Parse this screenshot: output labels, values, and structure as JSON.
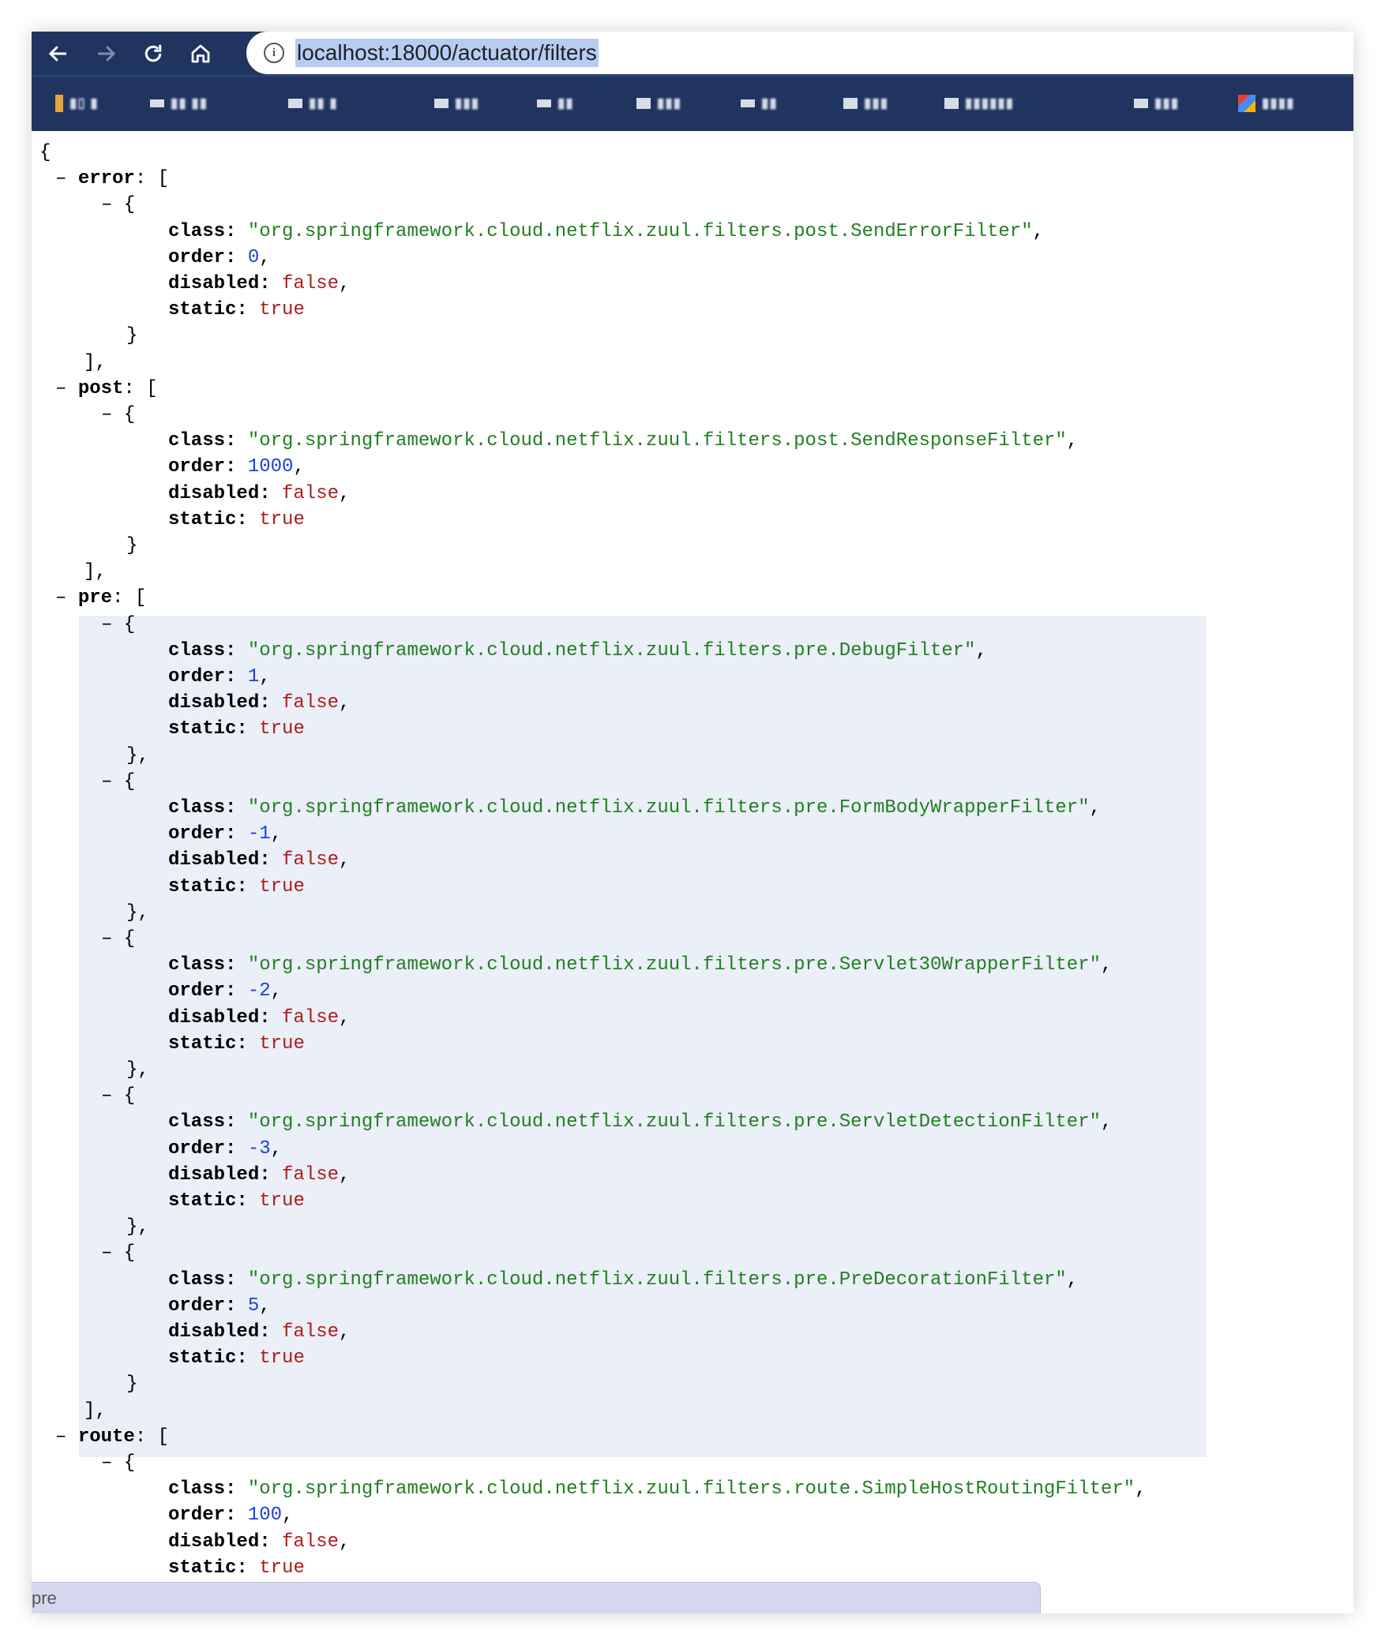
{
  "browser": {
    "url": "localhost:18000/actuator/filters",
    "nav": {
      "back": "←",
      "forward": "→",
      "reload": "⟳",
      "home": "⌂"
    },
    "bookmarks": [
      {
        "label": "▮▯ ▮"
      },
      {
        "label": "▮▮ ▮▮"
      },
      {
        "label": "▮▮ ▮"
      },
      {
        "label": "▮▮▮"
      },
      {
        "label": "▮▮"
      },
      {
        "label": "▮▮▮"
      },
      {
        "label": "▮▮"
      },
      {
        "label": "▮▮▮"
      },
      {
        "label": "▮▮▮▮▮▮"
      },
      {
        "label": "▮▮▮"
      },
      {
        "label": "▮▮▮▮"
      }
    ]
  },
  "json": {
    "open_brace": "{",
    "collapse_glyph": "–",
    "groups": [
      {
        "key": "error",
        "close": "],",
        "items": [
          {
            "class": "\"org.springframework.cloud.netflix.zuul.filters.post.SendErrorFilter\"",
            "order": "0",
            "disabled": "false",
            "static": "true",
            "close": "}"
          }
        ]
      },
      {
        "key": "post",
        "close": "],",
        "items": [
          {
            "class": "\"org.springframework.cloud.netflix.zuul.filters.post.SendResponseFilter\"",
            "order": "1000",
            "disabled": "false",
            "static": "true",
            "close": "}"
          }
        ]
      },
      {
        "key": "pre",
        "close": "],",
        "items": [
          {
            "class": "\"org.springframework.cloud.netflix.zuul.filters.pre.DebugFilter\"",
            "order": "1",
            "disabled": "false",
            "static": "true",
            "close": "},"
          },
          {
            "class": "\"org.springframework.cloud.netflix.zuul.filters.pre.FormBodyWrapperFilter\"",
            "order": "-1",
            "disabled": "false",
            "static": "true",
            "close": "},"
          },
          {
            "class": "\"org.springframework.cloud.netflix.zuul.filters.pre.Servlet30WrapperFilter\"",
            "order": "-2",
            "disabled": "false",
            "static": "true",
            "close": "},"
          },
          {
            "class": "\"org.springframework.cloud.netflix.zuul.filters.pre.ServletDetectionFilter\"",
            "order": "-3",
            "disabled": "false",
            "static": "true",
            "close": "},"
          },
          {
            "class": "\"org.springframework.cloud.netflix.zuul.filters.pre.PreDecorationFilter\"",
            "order": "5",
            "disabled": "false",
            "static": "true",
            "close": "}"
          }
        ]
      },
      {
        "key": "route",
        "close": "",
        "items": [
          {
            "class": "\"org.springframework.cloud.netflix.zuul.filters.route.SimpleHostRoutingFilter\"",
            "order": "100",
            "disabled": "false",
            "static": "true",
            "close": ""
          }
        ]
      }
    ]
  },
  "status_bar": {
    "text": "pre"
  },
  "colors": {
    "toolbar": "#1f3560",
    "string": "#218021",
    "number": "#1a3fe0",
    "boolean": "#b01c1c",
    "highlight": "#ebeff8"
  }
}
